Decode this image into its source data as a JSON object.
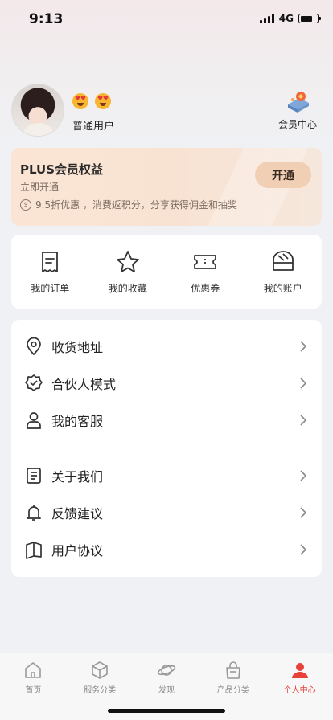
{
  "status_bar": {
    "time": "9:13",
    "network": "4G"
  },
  "profile": {
    "user_level": "普通用户",
    "member_center_label": "会员中心",
    "emojis": [
      "heart-eyes-emoji",
      "heart-eyes-emoji"
    ]
  },
  "plus": {
    "title": "PLUS会员权益",
    "subtitle": "立即开通",
    "description": "9.5折优惠 ，消费返积分，分享获得佣金和抽奖",
    "button": "开通",
    "icon": "coin-icon"
  },
  "quick_links": [
    {
      "label": "我的订单",
      "icon": "receipt-icon"
    },
    {
      "label": "我的收藏",
      "icon": "star-icon"
    },
    {
      "label": "优惠券",
      "icon": "ticket-icon"
    },
    {
      "label": "我的账户",
      "icon": "wallet-icon"
    }
  ],
  "menu_group1": [
    {
      "label": "收货地址",
      "icon": "location-pin-icon"
    },
    {
      "label": "合伙人模式",
      "icon": "badge-check-icon"
    },
    {
      "label": "我的客服",
      "icon": "person-icon"
    }
  ],
  "menu_group2": [
    {
      "label": "关于我们",
      "icon": "document-icon"
    },
    {
      "label": "反馈建议",
      "icon": "bell-icon"
    },
    {
      "label": "用户协议",
      "icon": "book-icon"
    }
  ],
  "tabbar": [
    {
      "label": "首页",
      "icon": "home-icon",
      "active": false
    },
    {
      "label": "服务分类",
      "icon": "cube-icon",
      "active": false
    },
    {
      "label": "发现",
      "icon": "planet-icon",
      "active": false
    },
    {
      "label": "产品分类",
      "icon": "bag-icon",
      "active": false
    },
    {
      "label": "个人中心",
      "icon": "user-icon",
      "active": true
    }
  ],
  "colors": {
    "accent": "#e8413a",
    "plus_button": "#f0cfb4",
    "plus_card": "#fbe4d4"
  }
}
